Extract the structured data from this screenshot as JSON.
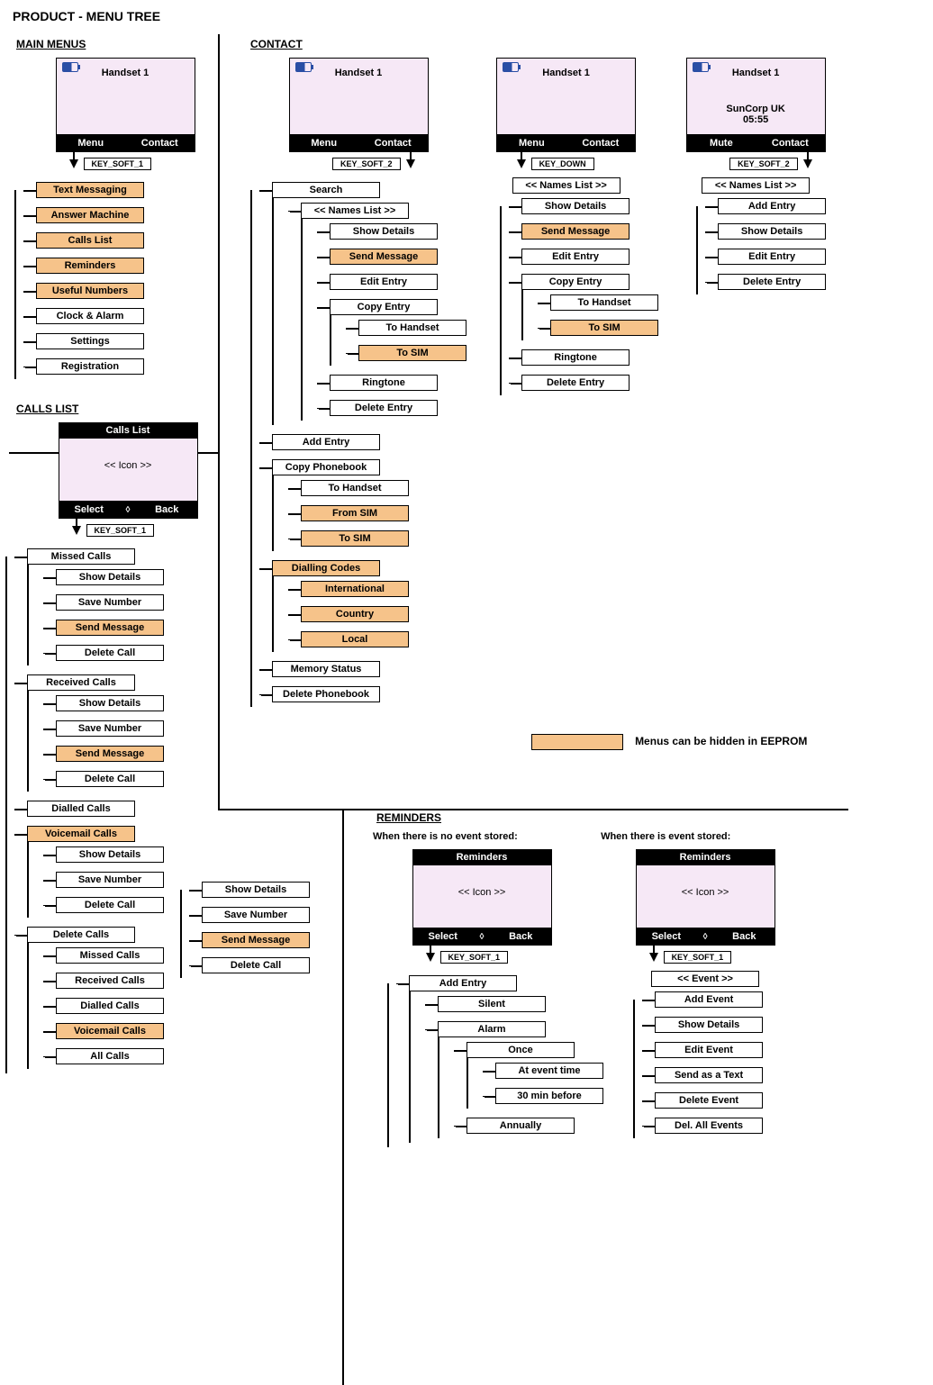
{
  "title": "PRODUCT - MENU TREE",
  "legend": "Menus can be hidden in EEPROM",
  "keys": {
    "soft1": "KEY_SOFT_1",
    "soft2": "KEY_SOFT_2",
    "down": "KEY_DOWN"
  },
  "phone_generic": {
    "title": "Handset   1",
    "soft_left": "Menu",
    "soft_right": "Contact"
  },
  "phone_idle2": {
    "title": "Handset   1",
    "line2": "SunCorp UK",
    "line3": "05:55",
    "soft_left": "Mute",
    "soft_right": "Contact"
  },
  "main_menus": {
    "heading": "MAIN MENUS",
    "items": [
      {
        "label": "Text Messaging",
        "hl": true
      },
      {
        "label": "Answer Machine",
        "hl": true
      },
      {
        "label": "Calls List",
        "hl": true
      },
      {
        "label": "Reminders",
        "hl": true
      },
      {
        "label": "Useful Numbers",
        "hl": true
      },
      {
        "label": "Clock & Alarm",
        "hl": false
      },
      {
        "label": "Settings",
        "hl": false
      },
      {
        "label": "Registration",
        "hl": false
      }
    ]
  },
  "contact": {
    "heading": "CONTACT",
    "col1_root": [
      {
        "label": "Search",
        "children_key": "names_list_full"
      },
      {
        "label": "Add Entry"
      },
      {
        "label": "Copy Phonebook",
        "children": [
          {
            "label": "To Handset"
          },
          {
            "label": "From SIM",
            "hl": true
          },
          {
            "label": "To SIM",
            "hl": true
          }
        ]
      },
      {
        "label": "Dialling Codes",
        "hl": true,
        "children": [
          {
            "label": "International",
            "hl": true
          },
          {
            "label": "Country",
            "hl": true
          },
          {
            "label": "Local",
            "hl": true
          }
        ]
      },
      {
        "label": "Memory Status"
      },
      {
        "label": "Delete Phonebook"
      }
    ],
    "names_list_full": {
      "header": "<< Names List >>",
      "items": [
        {
          "label": "Show Details"
        },
        {
          "label": "Send Message",
          "hl": true
        },
        {
          "label": "Edit Entry"
        },
        {
          "label": "Copy Entry",
          "children": [
            {
              "label": "To Handset"
            },
            {
              "label": "To SIM",
              "hl": true
            }
          ]
        },
        {
          "label": "Ringtone"
        },
        {
          "label": "Delete Entry"
        }
      ]
    },
    "col2_root": {
      "header": "<< Names List >>",
      "items": [
        {
          "label": "Show Details"
        },
        {
          "label": "Send Message",
          "hl": true
        },
        {
          "label": "Edit Entry"
        },
        {
          "label": "Copy Entry",
          "children": [
            {
              "label": "To Handset"
            },
            {
              "label": "To SIM",
              "hl": true
            }
          ]
        },
        {
          "label": "Ringtone"
        },
        {
          "label": "Delete Entry"
        }
      ]
    },
    "col3_root": {
      "header": "<< Names List >>",
      "items": [
        {
          "label": "Add Entry"
        },
        {
          "label": "Show Details"
        },
        {
          "label": "Edit Entry"
        },
        {
          "label": "Delete Entry"
        }
      ]
    }
  },
  "calls_list": {
    "heading": "CALLS LIST",
    "phone": {
      "title": "Calls List",
      "body": "<< Icon >>",
      "soft_left": "Select",
      "soft_right": "Back"
    },
    "root": [
      {
        "label": "Missed Calls",
        "children_key": "sub4"
      },
      {
        "label": "Received Calls",
        "children_key": "sub4"
      },
      {
        "label": "Dialled Calls"
      },
      {
        "label": "Voicemail Calls",
        "hl": true,
        "children_key": "sub3"
      },
      {
        "label": "Delete Calls",
        "children": [
          {
            "label": "Missed Calls"
          },
          {
            "label": "Received Calls"
          },
          {
            "label": "Dialled Calls"
          },
          {
            "label": "Voicemail Calls",
            "hl": true
          },
          {
            "label": "All Calls"
          }
        ]
      }
    ],
    "sub4": [
      {
        "label": "Show Details"
      },
      {
        "label": "Save Number"
      },
      {
        "label": "Send Message",
        "hl": true
      },
      {
        "label": "Delete Call"
      }
    ],
    "sub3": [
      {
        "label": "Show Details"
      },
      {
        "label": "Save Number"
      },
      {
        "label": "Delete Call"
      }
    ],
    "float": [
      {
        "label": "Show Details"
      },
      {
        "label": "Save Number"
      },
      {
        "label": "Send Message",
        "hl": true
      },
      {
        "label": "Delete Call"
      }
    ]
  },
  "reminders": {
    "heading": "REMINDERS",
    "caption_empty": "When there is no event stored:",
    "caption_stored": "When there is event stored:",
    "phone": {
      "title": "Reminders",
      "body": "<< Icon >>",
      "soft_left": "Select",
      "soft_right": "Back"
    },
    "empty_tree": [
      {
        "label": "Add Entry",
        "children": [
          {
            "label": "Silent"
          },
          {
            "label": "Alarm",
            "children": [
              {
                "label": "Once",
                "children": [
                  {
                    "label": "At event time"
                  },
                  {
                    "label": "30 min before"
                  }
                ]
              },
              {
                "label": "Annually"
              }
            ]
          }
        ]
      }
    ],
    "stored_header": "<< Event >>",
    "stored_tree": [
      {
        "label": "Add Event"
      },
      {
        "label": "Show Details"
      },
      {
        "label": "Edit Event"
      },
      {
        "label": "Send as a Text"
      },
      {
        "label": "Delete Event"
      },
      {
        "label": "Del. All Events"
      }
    ]
  }
}
